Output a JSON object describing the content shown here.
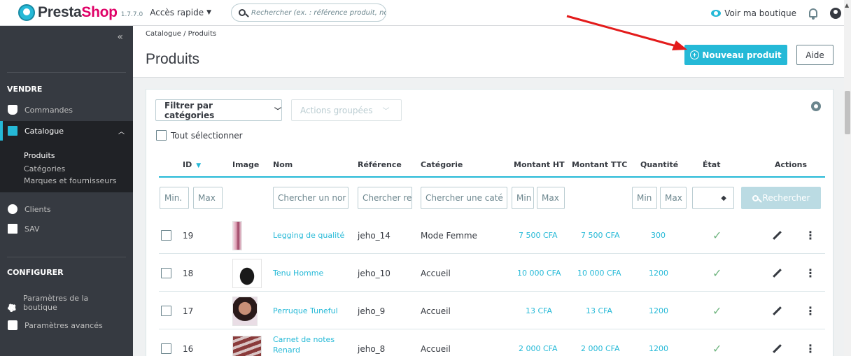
{
  "topbar": {
    "brand_main": "Presta",
    "brand_accent": "Shop",
    "version": "1.7.7.0",
    "quick_access": "Accès rapide",
    "search_placeholder": "Rechercher (ex. : référence produit, nom",
    "view_shop": "Voir ma boutique"
  },
  "sidebar": {
    "collapse": "«",
    "section_sell": "VENDRE",
    "items": [
      {
        "label": "Commandes",
        "icon": "cart-icon"
      },
      {
        "label": "Catalogue",
        "icon": "store-icon"
      },
      {
        "label": "Clients",
        "icon": "user-icon"
      },
      {
        "label": "SAV",
        "icon": "chat-icon"
      }
    ],
    "catalogue_sub": [
      "Produits",
      "Catégories",
      "Marques et fournisseurs"
    ],
    "section_configure": "CONFIGURER",
    "config_items": [
      {
        "label": "Paramètres de la boutique",
        "icon": "gear-icon"
      },
      {
        "label": "Paramètres avancés",
        "icon": "cog-icon"
      }
    ]
  },
  "header": {
    "breadcrumb": "Catalogue / Produits",
    "title": "Produits",
    "new_product": "Nouveau produit",
    "help": "Aide"
  },
  "toolbar": {
    "filter_categories": "Filtrer par catégories",
    "bulk_actions": "Actions groupées",
    "select_all": "Tout sélectionner"
  },
  "table": {
    "headers": {
      "id": "ID",
      "image": "Image",
      "name": "Nom",
      "reference": "Référence",
      "category": "Catégorie",
      "price_ht": "Montant HT",
      "price_ttc": "Montant TTC",
      "quantity": "Quantité",
      "status": "État",
      "actions": "Actions"
    },
    "filters": {
      "id_min": "Min.",
      "id_max": "Max",
      "name": "Chercher un nor",
      "reference": "Chercher re",
      "category": "Chercher une caté",
      "price_min": "Min",
      "price_max": "Max",
      "qty_min": "Min",
      "qty_max": "Max",
      "status": "◆",
      "search_button": "Rechercher"
    },
    "rows": [
      {
        "id": "19",
        "name": "Legging de qualité",
        "reference": "jeho_14",
        "category": "Mode Femme",
        "price_ht": "7 500 CFA",
        "price_ttc": "7 500 CFA",
        "quantity": "300",
        "status": "✓"
      },
      {
        "id": "18",
        "name": "Tenu Homme",
        "reference": "jeho_10",
        "category": "Accueil",
        "price_ht": "10 000 CFA",
        "price_ttc": "10 000 CFA",
        "quantity": "1200",
        "status": "✓"
      },
      {
        "id": "17",
        "name": "Perruque Tuneful",
        "reference": "jeho_9",
        "category": "Accueil",
        "price_ht": "13 CFA",
        "price_ttc": "13 CFA",
        "quantity": "1200",
        "status": "✓"
      },
      {
        "id": "16",
        "name": "Carnet de notes Renard",
        "reference": "jeho_8",
        "category": "Accueil",
        "price_ht": "2 000 CFA",
        "price_ttc": "2 000 CFA",
        "quantity": "1200",
        "status": "✓"
      }
    ]
  },
  "colors": {
    "accent": "#25b9d7",
    "sidebar_bg": "#363a41",
    "success": "#70b580",
    "arrow": "#e31b1b"
  }
}
